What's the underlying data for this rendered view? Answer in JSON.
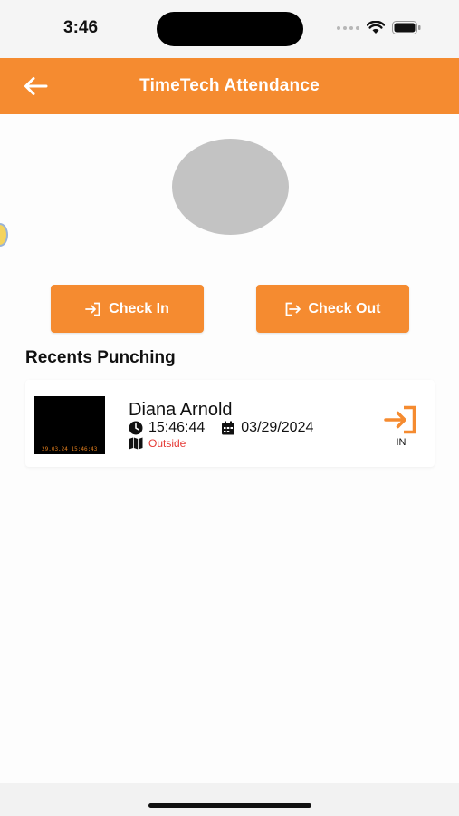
{
  "status_bar": {
    "time": "3:46",
    "icons": [
      "signal-dots-icon",
      "wifi-icon",
      "battery-icon"
    ]
  },
  "header": {
    "title": "TimeTech Attendance",
    "back_icon": "arrow-left-icon",
    "background_color": "#f58b30"
  },
  "actions": {
    "check_in_label": "Check In",
    "check_in_icon": "sign-in-icon",
    "check_out_label": "Check Out",
    "check_out_icon": "sign-out-icon",
    "button_color": "#f58b30"
  },
  "recents": {
    "title": "Recents Punching",
    "items": [
      {
        "name": "Diana Arnold",
        "time": "15:46:44",
        "date": "03/29/2024",
        "location": "Outside",
        "photo_stamp": "29.03.24 15:46:43",
        "status": "IN",
        "status_icon": "sign-in-icon",
        "location_color": "#e53935"
      }
    ]
  }
}
